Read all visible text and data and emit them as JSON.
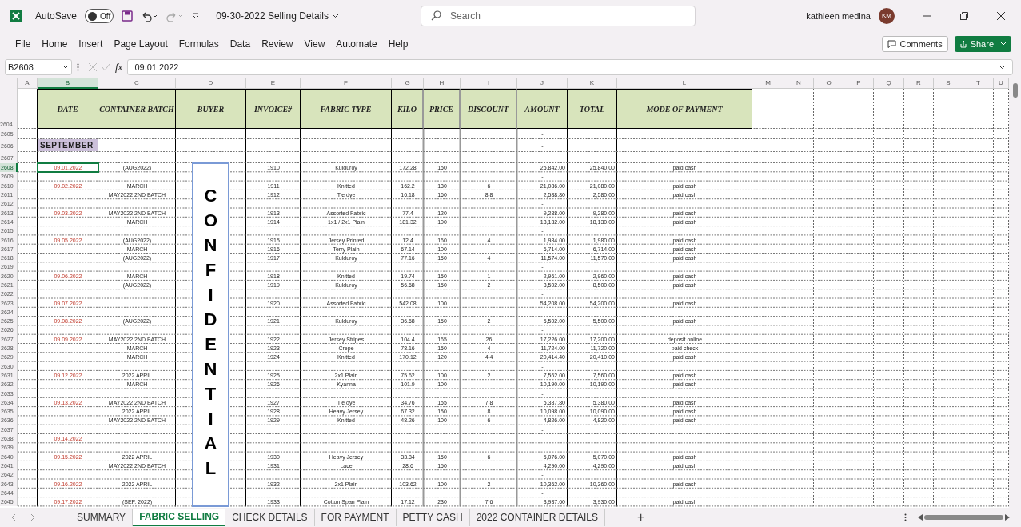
{
  "title_bar": {
    "autosave_label": "AutoSave",
    "autosave": {
      "on": false,
      "label": "Off"
    },
    "document_title": "09-30-2022 Selling Details",
    "search_placeholder": "Search",
    "user_name": "kathleen medina",
    "user_initials": "KM"
  },
  "menu": [
    {
      "label": "File",
      "selected": false
    },
    {
      "label": "Home",
      "selected": false
    },
    {
      "label": "Insert",
      "selected": false
    },
    {
      "label": "Page Layout",
      "selected": false
    },
    {
      "label": "Formulas",
      "selected": false
    },
    {
      "label": "Data",
      "selected": false
    },
    {
      "label": "Review",
      "selected": false
    },
    {
      "label": "View",
      "selected": false
    },
    {
      "label": "Automate",
      "selected": false
    },
    {
      "label": "Help",
      "selected": false
    }
  ],
  "comments_button": "Comments",
  "share_button": "Share",
  "formula_bar": {
    "name_box": "B2608",
    "fx": "fx",
    "value": "09.01.2022"
  },
  "columns": [
    {
      "letter": "A",
      "selected": false
    },
    {
      "letter": "B",
      "selected": true
    },
    {
      "letter": "C",
      "selected": false
    },
    {
      "letter": "D",
      "selected": false
    },
    {
      "letter": "E",
      "selected": false
    },
    {
      "letter": "F",
      "selected": false
    },
    {
      "letter": "G",
      "selected": false
    },
    {
      "letter": "H",
      "selected": false
    },
    {
      "letter": "I",
      "selected": false
    },
    {
      "letter": "J",
      "selected": false
    },
    {
      "letter": "K",
      "selected": false
    },
    {
      "letter": "L",
      "selected": false
    },
    {
      "letter": "M",
      "selected": false
    },
    {
      "letter": "N",
      "selected": false
    },
    {
      "letter": "O",
      "selected": false
    },
    {
      "letter": "P",
      "selected": false
    },
    {
      "letter": "Q",
      "selected": false
    },
    {
      "letter": "R",
      "selected": false
    },
    {
      "letter": "S",
      "selected": false
    },
    {
      "letter": "T",
      "selected": false
    },
    {
      "letter": "U",
      "selected": false
    }
  ],
  "header_row": {
    "num": "2604",
    "labels": [
      "DATE",
      "CONTAINER BATCH",
      "BUYER",
      "INVOICE#",
      "FABRIC TYPE",
      "KILO",
      "PRICE",
      "DISCOUNT",
      "AMOUNT",
      "TOTAL",
      "MODE OF PAYMENT"
    ]
  },
  "rows": [
    {
      "num": "2605",
      "selected": false,
      "cells": {
        "J": "-"
      }
    },
    {
      "num": "2606",
      "selected": false,
      "month": "SEPTEMBER",
      "cells": {
        "J": "-"
      }
    },
    {
      "num": "2607",
      "selected": false,
      "cells": {}
    },
    {
      "num": "2608",
      "selected": true,
      "cells": {
        "B": "09.01.2022",
        "C": "(AUG2022)",
        "E": "1910",
        "F": "Kulduroy",
        "G": "172.28",
        "H": "150",
        "J": "25,842.00",
        "K": "25,840.00",
        "L": "paid cash"
      }
    },
    {
      "num": "2609",
      "selected": false,
      "cells": {
        "J": "-"
      }
    },
    {
      "num": "2610",
      "selected": false,
      "cells": {
        "B": "09.02.2022",
        "C": "MARCH",
        "E": "1911",
        "F": "Knitted",
        "G": "162.2",
        "H": "130",
        "I": "6",
        "J": "21,086.00",
        "K": "21,080.00",
        "L": "paid cash"
      }
    },
    {
      "num": "2611",
      "selected": false,
      "cells": {
        "C": "MAY2022 2ND BATCH",
        "E": "1912",
        "F": "Tie dye",
        "G": "16.18",
        "H": "160",
        "I": "8.8",
        "J": "2,588.80",
        "K": "2,580.00",
        "L": "paid cash"
      }
    },
    {
      "num": "2612",
      "selected": false,
      "cells": {
        "J": "-"
      }
    },
    {
      "num": "2613",
      "selected": false,
      "cells": {
        "B": "09.03.2022",
        "C": "MAY2022 2ND BATCH",
        "E": "1913",
        "F": "Assorted Fabric",
        "G": "77.4",
        "H": "120",
        "J": "9,288.00",
        "K": "9,280.00",
        "L": "paid cash"
      }
    },
    {
      "num": "2614",
      "selected": false,
      "cells": {
        "C": "MARCH",
        "E": "1914",
        "F": "1x1 / 2x1 Plain",
        "G": "181.32",
        "H": "100",
        "J": "18,132.00",
        "K": "18,130.00",
        "L": "paid cash"
      }
    },
    {
      "num": "2615",
      "selected": false,
      "cells": {
        "J": "-"
      }
    },
    {
      "num": "2616",
      "selected": false,
      "cells": {
        "B": "09.05.2022",
        "C": "(AUG2022)",
        "E": "1915",
        "F": "Jersey Printed",
        "G": "12.4",
        "H": "160",
        "I": "4",
        "J": "1,984.00",
        "K": "1,980.00",
        "L": "paid cash"
      }
    },
    {
      "num": "2617",
      "selected": false,
      "cells": {
        "C": "MARCH",
        "E": "1916",
        "F": "Terry Plain",
        "G": "67.14",
        "H": "100",
        "J": "6,714.00",
        "K": "6,714.00",
        "L": "paid cash"
      }
    },
    {
      "num": "2618",
      "selected": false,
      "cells": {
        "C": "(AUG2022)",
        "E": "1917",
        "F": "Kulduroy",
        "G": "77.16",
        "H": "150",
        "I": "4",
        "J": "11,574.00",
        "K": "11,570.00",
        "L": "paid cash"
      }
    },
    {
      "num": "2619",
      "selected": false,
      "cells": {
        "J": "-"
      }
    },
    {
      "num": "2620",
      "selected": false,
      "cells": {
        "B": "09.06.2022",
        "C": "MARCH",
        "E": "1918",
        "F": "Knitted",
        "G": "19.74",
        "H": "150",
        "I": "1",
        "J": "2,961.00",
        "K": "2,960.00",
        "L": "paid cash"
      }
    },
    {
      "num": "2621",
      "selected": false,
      "cells": {
        "C": "(AUG2022)",
        "E": "1919",
        "F": "Kulduroy",
        "G": "56.68",
        "H": "150",
        "I": "2",
        "J": "8,502.00",
        "K": "8,500.00",
        "L": "paid cash"
      }
    },
    {
      "num": "2622",
      "selected": false,
      "cells": {
        "J": "-"
      }
    },
    {
      "num": "2623",
      "selected": false,
      "cells": {
        "B": "09.07.2022",
        "E": "1920",
        "F": "Assorted Fabric",
        "G": "542.08",
        "H": "100",
        "J": "54,208.00",
        "K": "54,200.00",
        "L": "paid cash"
      }
    },
    {
      "num": "2624",
      "selected": false,
      "cells": {
        "J": "-"
      }
    },
    {
      "num": "2625",
      "selected": false,
      "cells": {
        "B": "09.08.2022",
        "C": "(AUG2022)",
        "E": "1921",
        "F": "Kulduroy",
        "G": "36.68",
        "H": "150",
        "I": "2",
        "J": "5,502.00",
        "K": "5,500.00",
        "L": "paid cash"
      }
    },
    {
      "num": "2626",
      "selected": false,
      "cells": {
        "J": "-"
      }
    },
    {
      "num": "2627",
      "selected": false,
      "cells": {
        "B": "09.09.2022",
        "C": "MAY2022 2ND BATCH",
        "E": "1922",
        "F": "Jersey Stripes",
        "G": "104.4",
        "H": "165",
        "I": "26",
        "J": "17,226.00",
        "K": "17,200.00",
        "L": "deposit online"
      }
    },
    {
      "num": "2628",
      "selected": false,
      "cells": {
        "C": "MARCH",
        "E": "1923",
        "F": "Crepe",
        "G": "78.16",
        "H": "150",
        "I": "4",
        "J": "11,724.00",
        "K": "11,720.00",
        "L": "paid check"
      }
    },
    {
      "num": "2629",
      "selected": false,
      "cells": {
        "C": "MARCH",
        "E": "1924",
        "F": "Knitted",
        "G": "170.12",
        "H": "120",
        "I": "4.4",
        "J": "20,414.40",
        "K": "20,410.00",
        "L": "paid cash"
      }
    },
    {
      "num": "2630",
      "selected": false,
      "cells": {
        "J": "-"
      }
    },
    {
      "num": "2631",
      "selected": false,
      "cells": {
        "B": "09.12.2022",
        "C": "2022 APRIL",
        "E": "1925",
        "F": "2x1 Plain",
        "G": "75.62",
        "H": "100",
        "I": "2",
        "J": "7,562.00",
        "K": "7,560.00",
        "L": "paid cash"
      }
    },
    {
      "num": "2632",
      "selected": false,
      "cells": {
        "C": "MARCH",
        "E": "1926",
        "F": "Kyanna",
        "G": "101.9",
        "H": "100",
        "J": "10,190.00",
        "K": "10,190.00",
        "L": "paid cash"
      }
    },
    {
      "num": "2633",
      "selected": false,
      "cells": {
        "J": "-"
      }
    },
    {
      "num": "2634",
      "selected": false,
      "cells": {
        "B": "09.13.2022",
        "C": "MAY2022 2ND BATCH",
        "E": "1927",
        "F": "Tie dye",
        "G": "34.76",
        "H": "155",
        "I": "7.8",
        "J": "5,387.80",
        "K": "5,380.00",
        "L": "paid cash"
      }
    },
    {
      "num": "2635",
      "selected": false,
      "cells": {
        "C": "2022 APRIL",
        "E": "1928",
        "F": "Heavy Jersey",
        "G": "67.32",
        "H": "150",
        "I": "8",
        "J": "10,098.00",
        "K": "10,090.00",
        "L": "paid cash"
      }
    },
    {
      "num": "2636",
      "selected": false,
      "cells": {
        "C": "MAY2022 2ND BATCH",
        "E": "1929",
        "F": "Knitted",
        "G": "48.26",
        "H": "100",
        "I": "6",
        "J": "4,826.00",
        "K": "4,820.00",
        "L": "paid cash"
      }
    },
    {
      "num": "2637",
      "selected": false,
      "cells": {
        "J": "-"
      }
    },
    {
      "num": "2638",
      "selected": false,
      "cells": {
        "B": "09.14.2022"
      }
    },
    {
      "num": "2639",
      "selected": false,
      "cells": {}
    },
    {
      "num": "2640",
      "selected": false,
      "cells": {
        "B": "09.15.2022",
        "C": "2022 APRIL",
        "E": "1930",
        "F": "Heavy Jersey",
        "G": "33.84",
        "H": "150",
        "I": "6",
        "J": "5,076.00",
        "K": "5,070.00",
        "L": "paid cash"
      }
    },
    {
      "num": "2641",
      "selected": false,
      "cells": {
        "C": "MAY2022 2ND BATCH",
        "E": "1931",
        "F": "Lace",
        "G": "28.6",
        "H": "150",
        "J": "4,290.00",
        "K": "4,290.00",
        "L": "paid cash"
      }
    },
    {
      "num": "2642",
      "selected": false,
      "cells": {
        "J": "-"
      }
    },
    {
      "num": "2643",
      "selected": false,
      "cells": {
        "B": "09.16.2022",
        "C": "2022 APRIL",
        "E": "1932",
        "F": "2x1 Plain",
        "G": "103.62",
        "H": "100",
        "I": "2",
        "J": "10,362.00",
        "K": "10,360.00",
        "L": "paid cash"
      }
    },
    {
      "num": "2644",
      "selected": false,
      "cells": {
        "J": "-"
      }
    },
    {
      "num": "2645",
      "selected": false,
      "cells": {
        "B": "09.17.2022",
        "C": "(SEP. 2022)",
        "E": "1933",
        "F": "Cotton Span Plain",
        "G": "17.12",
        "H": "230",
        "I": "7.6",
        "J": "3,937.60",
        "K": "3,930.00",
        "L": "paid cash"
      }
    }
  ],
  "text_box": {
    "text": "CONFIDENTIAL"
  },
  "sheet_tabs": [
    {
      "label": "SUMMARY",
      "selected": false
    },
    {
      "label": "FABRIC SELLING",
      "selected": true
    },
    {
      "label": "CHECK DETAILS",
      "selected": false
    },
    {
      "label": "FOR PAYMENT",
      "selected": false
    },
    {
      "label": "PETTY CASH",
      "selected": false
    },
    {
      "label": "2022 CONTAINER DETAILS",
      "selected": false
    }
  ],
  "add_sheet": "+"
}
